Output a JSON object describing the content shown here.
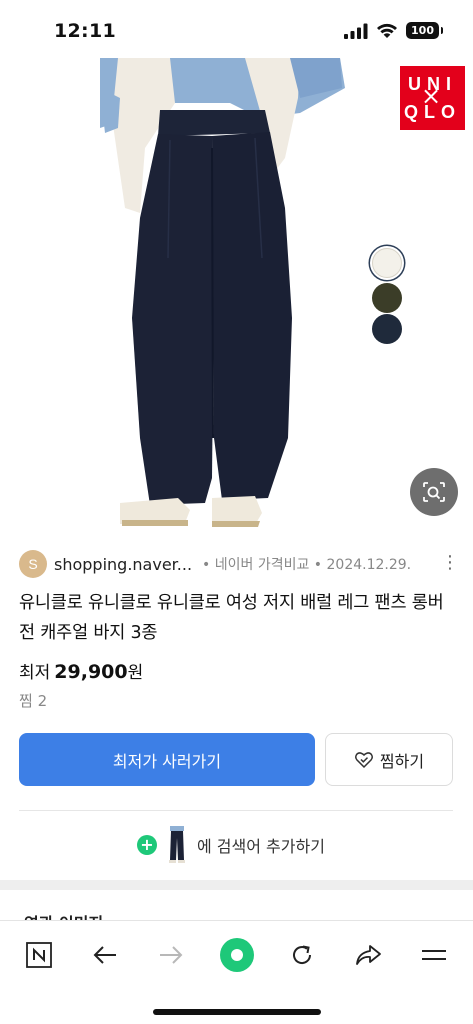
{
  "status_bar": {
    "time": "12:11",
    "battery": "100"
  },
  "hero": {
    "brand_logo": [
      "UNI",
      "QLO"
    ],
    "close_symbol": "×",
    "color_swatches": [
      {
        "color": "#f3f1ea",
        "selected": true
      },
      {
        "color": "#3b3d28",
        "selected": false
      },
      {
        "color": "#1f2a3b",
        "selected": false
      }
    ],
    "lens_icon": "image-search-icon"
  },
  "result": {
    "source_initial": "S",
    "source_domain": "shopping.naver...",
    "source_meta": "• 네이버 가격비교 • 2024.12.29.",
    "more_symbol": "⋮",
    "title": "유니클로 유니클로 유니클로 여성 저지 배럴 레그 팬츠 롱버전 캐주얼 바지 3종",
    "price_label": "최저",
    "price_value": "29,900",
    "price_unit": "원",
    "wish_count": "찜 2",
    "buy_button": "최저가 사러가기",
    "wish_button": "찜하기",
    "add_search": {
      "plus": "+",
      "label": "에 검색어 추가하기"
    },
    "next_section_title": "연관 이미지"
  },
  "toolbar": {
    "icons": [
      "naver-n-icon",
      "back-arrow-icon",
      "forward-arrow-icon",
      "green-dot-home-icon",
      "refresh-icon",
      "share-icon",
      "menu-icon"
    ]
  },
  "colors": {
    "accent_blue": "#3d7fe6",
    "green": "#1ec879",
    "uniqlo_red": "#e3001b"
  }
}
